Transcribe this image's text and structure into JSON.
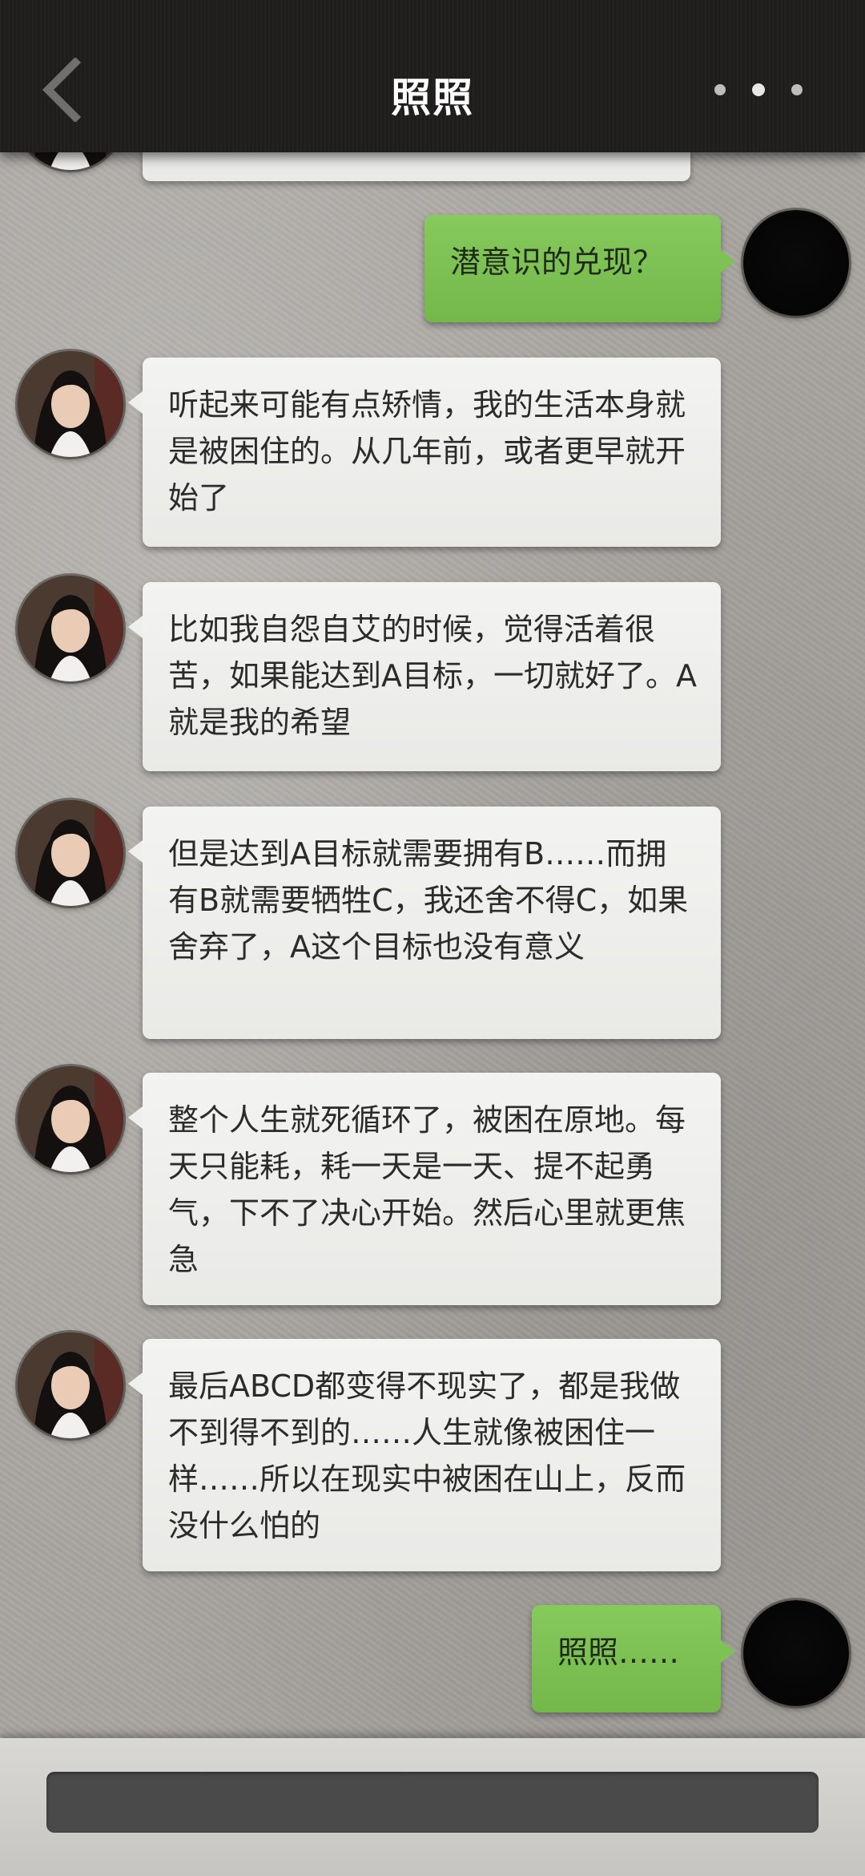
{
  "header": {
    "title": "照照",
    "back_icon": "chevron-left-icon",
    "more_icon": "more-dots-icon"
  },
  "messages": [
    {
      "side": "right",
      "text": "潜意识的兑现？"
    },
    {
      "side": "left",
      "text": "听起来可能有点矫情，我的生活本身就是被困住的。从几年前，或者更早就开始了"
    },
    {
      "side": "left",
      "text": "比如我自怨自艾的时候，觉得活着很苦，如果能达到A目标，一切就好了。A就是我的希望"
    },
    {
      "side": "left",
      "text": "但是达到A目标就需要拥有B……而拥有B就需要牺牲C，我还舍不得C，如果舍弃了，A这个目标也没有意义"
    },
    {
      "side": "left",
      "text": "整个人生就死循环了，被困在原地。每天只能耗，耗一天是一天、提不起勇气，下不了决心开始。然后心里就更焦急"
    },
    {
      "side": "left",
      "text": "最后ABCD都变得不现实了，都是我做不到得不到的……人生就像被困住一样……所以在现实中被困在山上，反而没什么怕的"
    },
    {
      "side": "right",
      "text": "照照……"
    }
  ],
  "input": {
    "value": "",
    "placeholder": ""
  },
  "colors": {
    "topbar": "#1f1e1d",
    "bubble_left": "#efefed",
    "bubble_right": "#7ec155",
    "background": "#a9a6a1",
    "input_bg": "#4a4a4a"
  }
}
